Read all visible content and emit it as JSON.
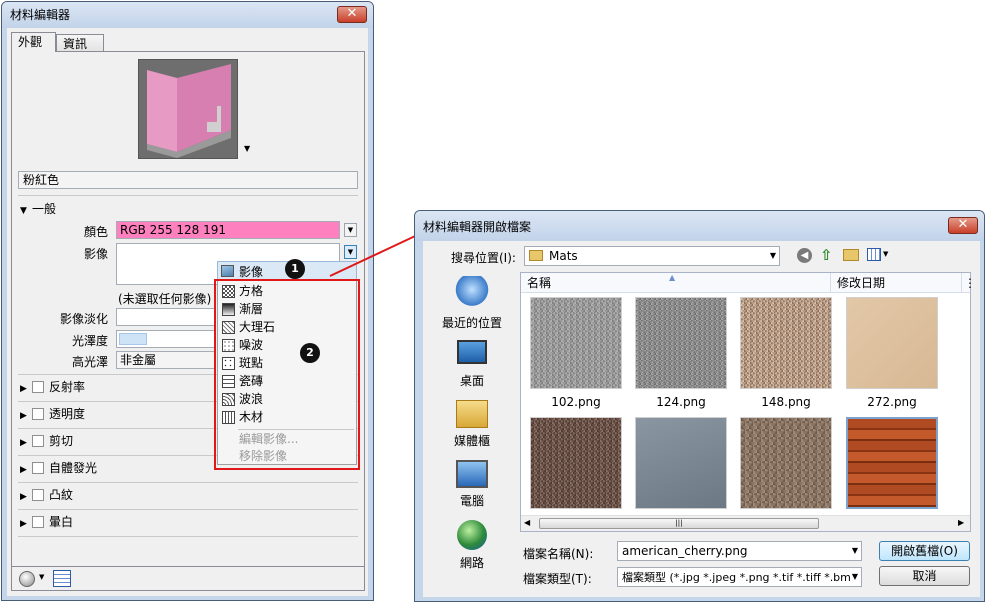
{
  "material_editor": {
    "title": "材料編輯器",
    "close_glyph": "✕",
    "tabs": [
      "外觀",
      "資訊"
    ],
    "material_name": "粉紅色",
    "general": {
      "header": "一般",
      "color_label": "顏色",
      "color_value": "RGB 255 128 191",
      "color_swatch": "#ff80bf",
      "image_label": "影像",
      "image_none": "(未選取任何影像)",
      "image_fade_label": "影像淡化",
      "glossiness_label": "光澤度",
      "highlights_label": "高光澤",
      "highlights_value": "非金屬"
    },
    "sections": [
      "反射率",
      "透明度",
      "剪切",
      "自體發光",
      "凸紋",
      "暈白"
    ],
    "image_menu": {
      "header": "影像",
      "items": [
        "方格",
        "漸層",
        "大理石",
        "噪波",
        "斑點",
        "瓷磚",
        "波浪",
        "木材"
      ],
      "disabled_items": [
        "編輯影像...",
        "移除影像"
      ]
    },
    "badges": [
      "1",
      "2"
    ]
  },
  "open_dialog": {
    "title": "材料編輯器開啟檔案",
    "close_glyph": "✕",
    "look_in_label": "搜尋位置(I):",
    "look_in_value": "Mats",
    "places": [
      "最近的位置",
      "桌面",
      "媒體櫃",
      "電腦",
      "網路"
    ],
    "columns": [
      "名稱",
      "修改日期"
    ],
    "files": [
      "102.png",
      "124.png",
      "148.png",
      "272.png"
    ],
    "file_name_label": "檔案名稱(N):",
    "file_name_value": "american_cherry.png",
    "file_type_label": "檔案類型(T):",
    "file_type_value": "檔案類型 (*.jpg *.jpeg *.png *.tif *.tiff *.bmp",
    "open_button": "開啟舊檔(O)",
    "cancel_button": "取消"
  },
  "colors": {
    "accent_red": "#e01818",
    "titlebar": "#c6d6ea"
  }
}
